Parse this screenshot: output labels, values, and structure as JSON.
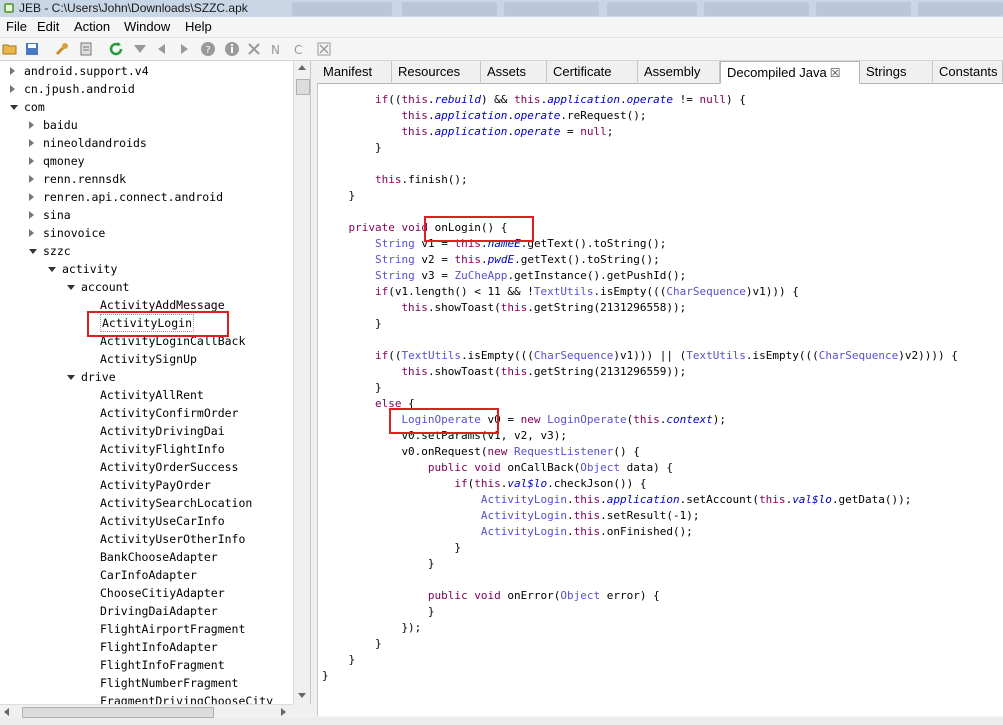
{
  "window": {
    "title": "JEB - C:\\Users\\John\\Downloads\\SZZC.apk"
  },
  "menu": [
    "File",
    "Edit",
    "Action",
    "Window",
    "Help"
  ],
  "toolbar_icons": [
    "open-folder-icon",
    "save-icon",
    "wrench-icon",
    "export-icon",
    "refresh-icon",
    "filter-icon",
    "back-arrow-icon",
    "forward-arrow-icon",
    "help-icon",
    "info-icon",
    "cross-reference-icon",
    "rename-icon",
    "comment-icon"
  ],
  "tree": [
    {
      "label": "android.support.v4",
      "level": 0,
      "state": "collapsed"
    },
    {
      "label": "cn.jpush.android",
      "level": 0,
      "state": "collapsed"
    },
    {
      "label": "com",
      "level": 0,
      "state": "expanded"
    },
    {
      "label": "baidu",
      "level": 1,
      "state": "collapsed"
    },
    {
      "label": "nineoldandroids",
      "level": 1,
      "state": "collapsed"
    },
    {
      "label": "qmoney",
      "level": 1,
      "state": "collapsed"
    },
    {
      "label": "renn.rennsdk",
      "level": 1,
      "state": "collapsed"
    },
    {
      "label": "renren.api.connect.android",
      "level": 1,
      "state": "collapsed"
    },
    {
      "label": "sina",
      "level": 1,
      "state": "collapsed"
    },
    {
      "label": "sinovoice",
      "level": 1,
      "state": "collapsed"
    },
    {
      "label": "szzc",
      "level": 1,
      "state": "expanded"
    },
    {
      "label": "activity",
      "level": 2,
      "state": "expanded"
    },
    {
      "label": "account",
      "level": 3,
      "state": "expanded"
    },
    {
      "label": "ActivityAddMessage",
      "level": 4,
      "state": "leaf"
    },
    {
      "label": "ActivityLogin",
      "level": 4,
      "state": "leaf",
      "selected": true
    },
    {
      "label": "ActivityLoginCallBack",
      "level": 4,
      "state": "leaf"
    },
    {
      "label": "ActivitySignUp",
      "level": 4,
      "state": "leaf"
    },
    {
      "label": "drive",
      "level": 3,
      "state": "expanded"
    },
    {
      "label": "ActivityAllRent",
      "level": 4,
      "state": "leaf"
    },
    {
      "label": "ActivityConfirmOrder",
      "level": 4,
      "state": "leaf"
    },
    {
      "label": "ActivityDrivingDai",
      "level": 4,
      "state": "leaf"
    },
    {
      "label": "ActivityFlightInfo",
      "level": 4,
      "state": "leaf"
    },
    {
      "label": "ActivityOrderSuccess",
      "level": 4,
      "state": "leaf"
    },
    {
      "label": "ActivityPayOrder",
      "level": 4,
      "state": "leaf"
    },
    {
      "label": "ActivitySearchLocation",
      "level": 4,
      "state": "leaf"
    },
    {
      "label": "ActivityUseCarInfo",
      "level": 4,
      "state": "leaf"
    },
    {
      "label": "ActivityUserOtherInfo",
      "level": 4,
      "state": "leaf"
    },
    {
      "label": "BankChooseAdapter",
      "level": 4,
      "state": "leaf"
    },
    {
      "label": "CarInfoAdapter",
      "level": 4,
      "state": "leaf"
    },
    {
      "label": "ChooseCitiyAdapter",
      "level": 4,
      "state": "leaf"
    },
    {
      "label": "DrivingDaiAdapter",
      "level": 4,
      "state": "leaf"
    },
    {
      "label": "FlightAirportFragment",
      "level": 4,
      "state": "leaf"
    },
    {
      "label": "FlightInfoAdapter",
      "level": 4,
      "state": "leaf"
    },
    {
      "label": "FlightInfoFragment",
      "level": 4,
      "state": "leaf"
    },
    {
      "label": "FlightNumberFragment",
      "level": 4,
      "state": "leaf"
    },
    {
      "label": "FragmentDrivingChooseCity",
      "level": 4,
      "state": "leaf"
    }
  ],
  "tabs": [
    {
      "label": "Manifest"
    },
    {
      "label": "Resources"
    },
    {
      "label": "Assets"
    },
    {
      "label": "Certificate"
    },
    {
      "label": "Assembly"
    },
    {
      "label": "Decompiled Java",
      "active": true,
      "closable": true
    },
    {
      "label": "Strings"
    },
    {
      "label": "Constants"
    }
  ],
  "code": [
    [
      [
        8,
        ""
      ],
      [
        "kw",
        "if"
      ],
      [
        "",
        "(("
      ],
      [
        "kw",
        "this"
      ],
      [
        "",
        "."
      ],
      [
        "fd",
        "rebuild"
      ],
      [
        "",
        ") && "
      ],
      [
        "kw",
        "this"
      ],
      [
        "",
        "."
      ],
      [
        "fd",
        "application"
      ],
      [
        "",
        "."
      ],
      [
        "fd",
        "operate"
      ],
      [
        "",
        " != "
      ],
      [
        "kw",
        "null"
      ],
      [
        "",
        ") {"
      ]
    ],
    [
      [
        12,
        ""
      ],
      [
        "kw",
        "this"
      ],
      [
        "",
        "."
      ],
      [
        "fd",
        "application"
      ],
      [
        "",
        "."
      ],
      [
        "fd",
        "operate"
      ],
      [
        "",
        ".reRequest();"
      ]
    ],
    [
      [
        12,
        ""
      ],
      [
        "kw",
        "this"
      ],
      [
        "",
        "."
      ],
      [
        "fd",
        "application"
      ],
      [
        "",
        "."
      ],
      [
        "fd",
        "operate"
      ],
      [
        "",
        " = "
      ],
      [
        "kw",
        "null"
      ],
      [
        "",
        ";"
      ]
    ],
    [
      [
        8,
        ""
      ],
      [
        "",
        "}"
      ]
    ],
    [
      [
        0,
        ""
      ]
    ],
    [
      [
        8,
        ""
      ],
      [
        "kw",
        "this"
      ],
      [
        "",
        ".finish();"
      ]
    ],
    [
      [
        4,
        ""
      ],
      [
        "",
        "}"
      ]
    ],
    [
      [
        0,
        ""
      ]
    ],
    [
      [
        4,
        ""
      ],
      [
        "kw",
        "private void"
      ],
      [
        "",
        " onLogin() {"
      ]
    ],
    [
      [
        8,
        ""
      ],
      [
        "ty",
        "String"
      ],
      [
        "",
        " v1 = "
      ],
      [
        "kw",
        "this"
      ],
      [
        "",
        "."
      ],
      [
        "fd",
        "nameE"
      ],
      [
        "",
        ".getText().toString();"
      ]
    ],
    [
      [
        8,
        ""
      ],
      [
        "ty",
        "String"
      ],
      [
        "",
        " v2 = "
      ],
      [
        "kw",
        "this"
      ],
      [
        "",
        "."
      ],
      [
        "fd",
        "pwdE"
      ],
      [
        "",
        ".getText().toString();"
      ]
    ],
    [
      [
        8,
        ""
      ],
      [
        "ty",
        "String"
      ],
      [
        "",
        " v3 = "
      ],
      [
        "ty",
        "ZuCheApp"
      ],
      [
        "",
        ".getInstance().getPushId();"
      ]
    ],
    [
      [
        8,
        ""
      ],
      [
        "kw",
        "if"
      ],
      [
        "",
        "(v1.length() < "
      ],
      [
        "",
        "11"
      ],
      [
        "",
        " && !"
      ],
      [
        "ty",
        "TextUtils"
      ],
      [
        "",
        ".isEmpty((("
      ],
      [
        "ty",
        "CharSequence"
      ],
      [
        "",
        ")v1))) {"
      ]
    ],
    [
      [
        12,
        ""
      ],
      [
        "kw",
        "this"
      ],
      [
        "",
        ".showToast("
      ],
      [
        "kw",
        "this"
      ],
      [
        "",
        ".getString("
      ],
      [
        "",
        "2131296558"
      ],
      [
        "",
        "));"
      ]
    ],
    [
      [
        8,
        ""
      ],
      [
        "",
        "}"
      ]
    ],
    [
      [
        0,
        ""
      ]
    ],
    [
      [
        8,
        ""
      ],
      [
        "kw",
        "if"
      ],
      [
        "",
        "(("
      ],
      [
        "ty",
        "TextUtils"
      ],
      [
        "",
        ".isEmpty((("
      ],
      [
        "ty",
        "CharSequence"
      ],
      [
        "",
        ")v1))) || ("
      ],
      [
        "ty",
        "TextUtils"
      ],
      [
        "",
        ".isEmpty((("
      ],
      [
        "ty",
        "CharSequence"
      ],
      [
        "",
        ")v2)))) {"
      ]
    ],
    [
      [
        12,
        ""
      ],
      [
        "kw",
        "this"
      ],
      [
        "",
        ".showToast("
      ],
      [
        "kw",
        "this"
      ],
      [
        "",
        ".getString("
      ],
      [
        "",
        "2131296559"
      ],
      [
        "",
        "));"
      ]
    ],
    [
      [
        8,
        ""
      ],
      [
        "",
        "}"
      ]
    ],
    [
      [
        8,
        ""
      ],
      [
        "kw",
        "else"
      ],
      [
        "",
        " {"
      ]
    ],
    [
      [
        12,
        ""
      ],
      [
        "ty",
        "LoginOperate"
      ],
      [
        "",
        " v0 = "
      ],
      [
        "kw",
        "new"
      ],
      [
        "",
        " "
      ],
      [
        "ty",
        "LoginOperate"
      ],
      [
        "",
        "("
      ],
      [
        "kw",
        "this"
      ],
      [
        "",
        "."
      ],
      [
        "fd",
        "context"
      ],
      [
        "",
        ");"
      ]
    ],
    [
      [
        12,
        ""
      ],
      [
        "",
        "v0.setParams(v1, v2, v3);"
      ]
    ],
    [
      [
        12,
        ""
      ],
      [
        "",
        "v0.onRequest("
      ],
      [
        "kw",
        "new"
      ],
      [
        "",
        " "
      ],
      [
        "ty",
        "RequestListener"
      ],
      [
        "",
        "() {"
      ]
    ],
    [
      [
        16,
        ""
      ],
      [
        "kw",
        "public void"
      ],
      [
        "",
        " onCallBack("
      ],
      [
        "ty",
        "Object"
      ],
      [
        "",
        " data) {"
      ]
    ],
    [
      [
        20,
        ""
      ],
      [
        "kw",
        "if"
      ],
      [
        "",
        "("
      ],
      [
        "kw",
        "this"
      ],
      [
        "",
        "."
      ],
      [
        "fd",
        "val$lo"
      ],
      [
        "",
        ".checkJson()) {"
      ]
    ],
    [
      [
        24,
        ""
      ],
      [
        "ty",
        "ActivityLogin"
      ],
      [
        "",
        "."
      ],
      [
        "kw",
        "this"
      ],
      [
        "",
        "."
      ],
      [
        "fd",
        "application"
      ],
      [
        "",
        ".setAccount("
      ],
      [
        "kw",
        "this"
      ],
      [
        "",
        "."
      ],
      [
        "fd",
        "val$lo"
      ],
      [
        "",
        ".getData());"
      ]
    ],
    [
      [
        24,
        ""
      ],
      [
        "ty",
        "ActivityLogin"
      ],
      [
        "",
        "."
      ],
      [
        "kw",
        "this"
      ],
      [
        "",
        ".setResult("
      ],
      [
        "",
        "-1"
      ],
      [
        "",
        ");"
      ]
    ],
    [
      [
        24,
        ""
      ],
      [
        "ty",
        "ActivityLogin"
      ],
      [
        "",
        "."
      ],
      [
        "kw",
        "this"
      ],
      [
        "",
        ".onFinished();"
      ]
    ],
    [
      [
        20,
        ""
      ],
      [
        "",
        "}"
      ]
    ],
    [
      [
        16,
        ""
      ],
      [
        "",
        "}"
      ]
    ],
    [
      [
        0,
        ""
      ]
    ],
    [
      [
        16,
        ""
      ],
      [
        "kw",
        "public void"
      ],
      [
        "",
        " onError("
      ],
      [
        "ty",
        "Object"
      ],
      [
        "",
        " error) {"
      ]
    ],
    [
      [
        16,
        ""
      ],
      [
        "",
        "}"
      ]
    ],
    [
      [
        12,
        ""
      ],
      [
        "",
        "});"
      ]
    ],
    [
      [
        8,
        ""
      ],
      [
        "",
        "}"
      ]
    ],
    [
      [
        4,
        ""
      ],
      [
        "",
        "}"
      ]
    ],
    [
      [
        0,
        ""
      ],
      [
        "",
        "}"
      ]
    ]
  ],
  "colors": {
    "highlight_box": "#e02020",
    "keyword": "#7f0055",
    "type": "#5b4fd0",
    "field": "#0000c0"
  }
}
